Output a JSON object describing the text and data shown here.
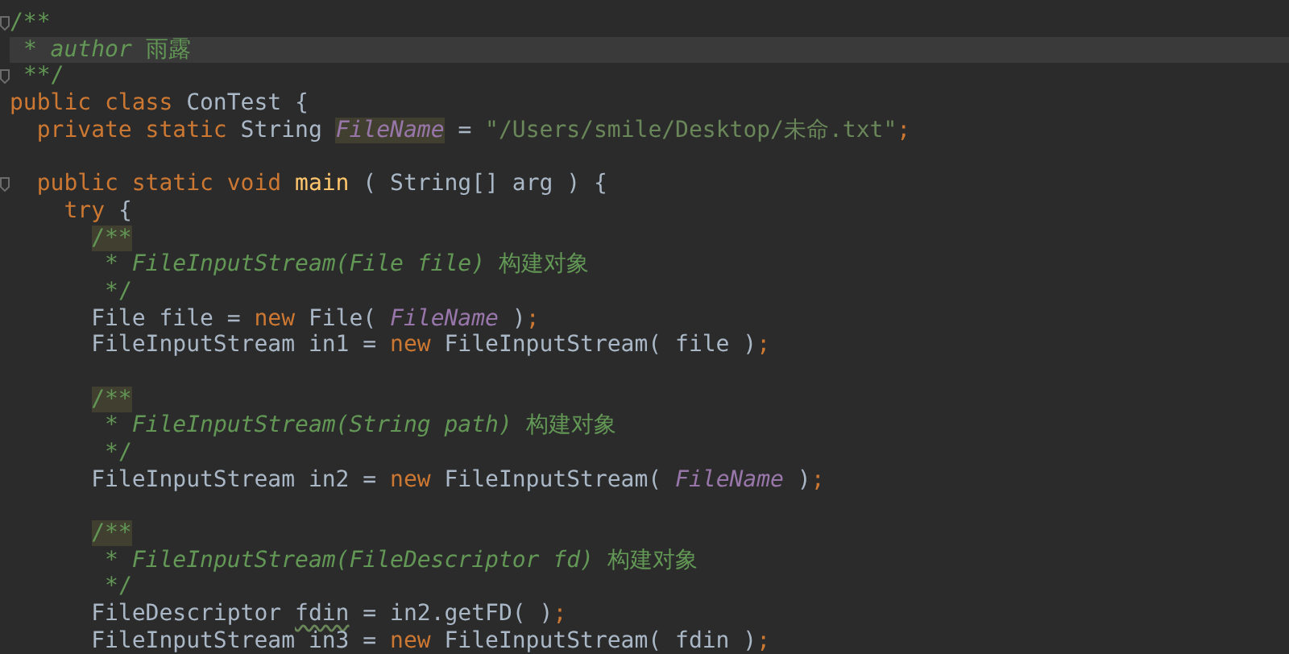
{
  "editor": {
    "lines": [
      {
        "kind": "code",
        "current": false,
        "fold": true,
        "tokens": [
          {
            "text": "/**",
            "kind": "comment"
          }
        ]
      },
      {
        "kind": "code",
        "current": true,
        "fold": false,
        "tokens": [
          {
            "text": " * ",
            "kind": "comment"
          },
          {
            "text": "author",
            "kind": "doc"
          },
          {
            "text": " 雨露",
            "kind": "comment"
          }
        ]
      },
      {
        "kind": "code",
        "current": false,
        "fold": true,
        "tokens": [
          {
            "text": " **/",
            "kind": "comment"
          }
        ]
      },
      {
        "kind": "code",
        "current": false,
        "fold": false,
        "tokens": [
          {
            "text": "public class ",
            "kind": "keyword"
          },
          {
            "text": "ConTest {",
            "kind": "plain"
          }
        ]
      },
      {
        "kind": "code",
        "current": false,
        "fold": false,
        "tokens": [
          {
            "text": "  private static ",
            "kind": "keyword"
          },
          {
            "text": "String ",
            "kind": "plain"
          },
          {
            "text": "FileName",
            "kind": "field-marked"
          },
          {
            "text": " = ",
            "kind": "plain"
          },
          {
            "text": "\"/Users/smile/Desktop/未命.txt\"",
            "kind": "string"
          },
          {
            "text": ";",
            "kind": "punct"
          }
        ]
      },
      {
        "kind": "blank"
      },
      {
        "kind": "code",
        "current": false,
        "fold": true,
        "tokens": [
          {
            "text": "  public static void ",
            "kind": "keyword"
          },
          {
            "text": "main",
            "kind": "method"
          },
          {
            "text": " ( String[] arg ) {",
            "kind": "plain"
          }
        ]
      },
      {
        "kind": "code",
        "current": false,
        "fold": false,
        "tokens": [
          {
            "text": "    try ",
            "kind": "keyword"
          },
          {
            "text": "{",
            "kind": "plain"
          }
        ]
      },
      {
        "kind": "code",
        "current": false,
        "fold": false,
        "tokens": [
          {
            "text": "      /**",
            "kind": "comment-marked"
          }
        ]
      },
      {
        "kind": "code",
        "current": false,
        "fold": false,
        "tokens": [
          {
            "text": "       * ",
            "kind": "comment"
          },
          {
            "text": "FileInputStream(File file)",
            "kind": "doc"
          },
          {
            "text": " 构建对象",
            "kind": "comment"
          }
        ]
      },
      {
        "kind": "code",
        "current": false,
        "fold": false,
        "tokens": [
          {
            "text": "       */",
            "kind": "comment"
          }
        ]
      },
      {
        "kind": "code",
        "current": false,
        "fold": false,
        "tokens": [
          {
            "text": "      File file = ",
            "kind": "plain"
          },
          {
            "text": "new ",
            "kind": "keyword"
          },
          {
            "text": "File( ",
            "kind": "plain"
          },
          {
            "text": "FileName",
            "kind": "field"
          },
          {
            "text": " )",
            "kind": "plain"
          },
          {
            "text": ";",
            "kind": "punct"
          }
        ]
      },
      {
        "kind": "code",
        "current": false,
        "fold": false,
        "tokens": [
          {
            "text": "      FileInputStream in1 = ",
            "kind": "plain"
          },
          {
            "text": "new ",
            "kind": "keyword"
          },
          {
            "text": "FileInputStream( file )",
            "kind": "plain"
          },
          {
            "text": ";",
            "kind": "punct"
          }
        ]
      },
      {
        "kind": "blank"
      },
      {
        "kind": "code",
        "current": false,
        "fold": false,
        "tokens": [
          {
            "text": "      /**",
            "kind": "comment-marked"
          }
        ]
      },
      {
        "kind": "code",
        "current": false,
        "fold": false,
        "tokens": [
          {
            "text": "       * ",
            "kind": "comment"
          },
          {
            "text": "FileInputStream(String path)",
            "kind": "doc"
          },
          {
            "text": " 构建对象",
            "kind": "comment"
          }
        ]
      },
      {
        "kind": "code",
        "current": false,
        "fold": false,
        "tokens": [
          {
            "text": "       */",
            "kind": "comment"
          }
        ]
      },
      {
        "kind": "code",
        "current": false,
        "fold": false,
        "tokens": [
          {
            "text": "      FileInputStream in2 = ",
            "kind": "plain"
          },
          {
            "text": "new ",
            "kind": "keyword"
          },
          {
            "text": "FileInputStream( ",
            "kind": "plain"
          },
          {
            "text": "FileName",
            "kind": "field"
          },
          {
            "text": " )",
            "kind": "plain"
          },
          {
            "text": ";",
            "kind": "punct"
          }
        ]
      },
      {
        "kind": "blank"
      },
      {
        "kind": "code",
        "current": false,
        "fold": false,
        "tokens": [
          {
            "text": "      /**",
            "kind": "comment-marked"
          }
        ]
      },
      {
        "kind": "code",
        "current": false,
        "fold": false,
        "tokens": [
          {
            "text": "       * ",
            "kind": "comment"
          },
          {
            "text": "FileInputStream(FileDescriptor fd)",
            "kind": "doc"
          },
          {
            "text": " 构建对象",
            "kind": "comment"
          }
        ]
      },
      {
        "kind": "code",
        "current": false,
        "fold": false,
        "tokens": [
          {
            "text": "       */",
            "kind": "comment"
          }
        ]
      },
      {
        "kind": "code",
        "current": false,
        "fold": false,
        "tokens": [
          {
            "text": "      FileDescriptor ",
            "kind": "plain"
          },
          {
            "text": "fdin",
            "kind": "plain-warned"
          },
          {
            "text": " = in2.getFD( )",
            "kind": "plain"
          },
          {
            "text": ";",
            "kind": "punct"
          }
        ]
      },
      {
        "kind": "code",
        "current": false,
        "fold": false,
        "tokens": [
          {
            "text": "      FileInputStream in3 = ",
            "kind": "plain"
          },
          {
            "text": "new ",
            "kind": "keyword"
          },
          {
            "text": "FileInputStream( fdin )",
            "kind": "plain"
          },
          {
            "text": ";",
            "kind": "punct"
          }
        ]
      }
    ]
  }
}
